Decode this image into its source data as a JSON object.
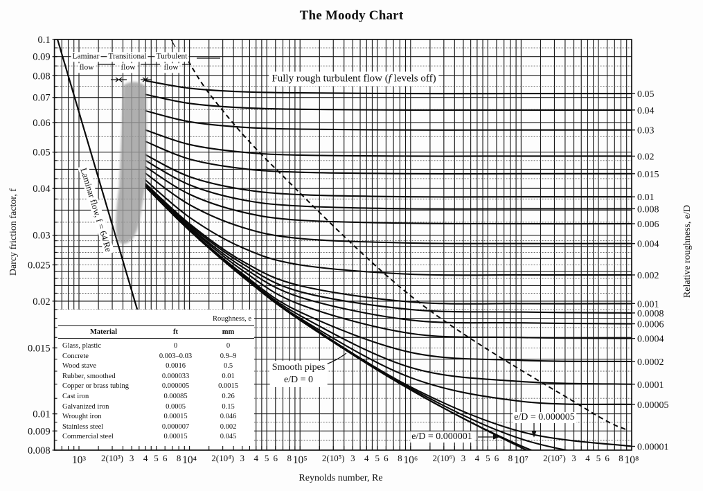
{
  "chart_data": {
    "type": "line",
    "title": "The Moody Chart",
    "xlabel": "Reynolds number, Re",
    "ylabel": "Darcy friction factor, f",
    "y2label": "Relative roughness, e/D",
    "xscale": "log",
    "yscale": "log",
    "xlim": [
      600,
      100000000
    ],
    "ylim": [
      0.008,
      0.1
    ],
    "grid": true,
    "legend": "none",
    "x_ticks": [
      {
        "label": "10³",
        "value": 1000
      },
      {
        "label": "2(10³)",
        "value": 2000
      },
      {
        "label": "3",
        "value": 3000
      },
      {
        "label": "4",
        "value": 4000
      },
      {
        "label": "5",
        "value": 5000
      },
      {
        "label": "6",
        "value": 6000
      },
      {
        "label": "8",
        "value": 8000
      },
      {
        "label": "10⁴",
        "value": 10000
      },
      {
        "label": "2(10⁴)",
        "value": 20000
      },
      {
        "label": "3",
        "value": 30000
      },
      {
        "label": "4",
        "value": 40000
      },
      {
        "label": "5",
        "value": 50000
      },
      {
        "label": "6",
        "value": 60000
      },
      {
        "label": "8",
        "value": 80000
      },
      {
        "label": "10⁵",
        "value": 100000
      },
      {
        "label": "2(10⁵)",
        "value": 200000
      },
      {
        "label": "3",
        "value": 300000
      },
      {
        "label": "4",
        "value": 400000
      },
      {
        "label": "5",
        "value": 500000
      },
      {
        "label": "6",
        "value": 600000
      },
      {
        "label": "8",
        "value": 800000
      },
      {
        "label": "10⁶",
        "value": 1000000
      },
      {
        "label": "2(10⁶)",
        "value": 2000000
      },
      {
        "label": "3",
        "value": 3000000
      },
      {
        "label": "4",
        "value": 4000000
      },
      {
        "label": "5",
        "value": 5000000
      },
      {
        "label": "6",
        "value": 6000000
      },
      {
        "label": "8",
        "value": 8000000
      },
      {
        "label": "10⁷",
        "value": 10000000
      },
      {
        "label": "2(10⁷)",
        "value": 20000000
      },
      {
        "label": "3",
        "value": 30000000
      },
      {
        "label": "4",
        "value": 40000000
      },
      {
        "label": "5",
        "value": 50000000
      },
      {
        "label": "6",
        "value": 60000000
      },
      {
        "label": "8",
        "value": 80000000
      },
      {
        "label": "10⁸",
        "value": 100000000
      }
    ],
    "y_ticks": [
      {
        "label": "0.1",
        "value": 0.1
      },
      {
        "label": "0.09",
        "value": 0.09
      },
      {
        "label": "0.08",
        "value": 0.08
      },
      {
        "label": "0.07",
        "value": 0.07
      },
      {
        "label": "0.06",
        "value": 0.06
      },
      {
        "label": "0.05",
        "value": 0.05
      },
      {
        "label": "0.04",
        "value": 0.04
      },
      {
        "label": "0.03",
        "value": 0.03
      },
      {
        "label": "0.025",
        "value": 0.025
      },
      {
        "label": "0.02",
        "value": 0.02
      },
      {
        "label": "0.015",
        "value": 0.015
      },
      {
        "label": "0.01",
        "value": 0.01
      },
      {
        "label": "0.009",
        "value": 0.009
      },
      {
        "label": "0.008",
        "value": 0.008
      }
    ],
    "x": [
      4000,
      10000,
      30000,
      100000,
      1000000,
      10000000,
      100000000
    ],
    "series": [
      {
        "name": "e/D = 0.05",
        "relative_roughness": 0.05,
        "right_label": "0.05",
        "values": [
          0.0776,
          0.0741,
          0.0725,
          0.072,
          0.0717,
          0.0717,
          0.0717
        ]
      },
      {
        "name": "e/D = 0.04",
        "relative_roughness": 0.04,
        "right_label": "0.04",
        "values": [
          0.0713,
          0.0675,
          0.0657,
          0.0651,
          0.0648,
          0.0648,
          0.0648
        ]
      },
      {
        "name": "e/D = 0.03",
        "relative_roughness": 0.03,
        "right_label": "0.03",
        "values": [
          0.0645,
          0.0603,
          0.0583,
          0.0576,
          0.0573,
          0.0573,
          0.0573
        ]
      },
      {
        "name": "e/D = 0.02",
        "relative_roughness": 0.02,
        "right_label": "0.02",
        "values": [
          0.0573,
          0.0524,
          0.05,
          0.0491,
          0.0488,
          0.0488,
          0.0488
        ]
      },
      {
        "name": "e/D = 0.015",
        "relative_roughness": 0.015,
        "right_label": "0.015",
        "values": [
          0.0534,
          0.0479,
          0.0452,
          0.0442,
          0.0438,
          0.0438,
          0.0438
        ]
      },
      {
        "name": "e/D = 0.01",
        "relative_roughness": 0.01,
        "right_label": "0.01",
        "values": [
          0.0492,
          0.043,
          0.0398,
          0.0385,
          0.038,
          0.038,
          0.038
        ]
      },
      {
        "name": "e/D = 0.008",
        "relative_roughness": 0.008,
        "right_label": "0.008",
        "values": [
          0.0475,
          0.0409,
          0.0373,
          0.0359,
          0.0353,
          0.0353,
          0.0353
        ]
      },
      {
        "name": "e/D = 0.006",
        "relative_roughness": 0.006,
        "right_label": "0.006",
        "values": [
          0.0457,
          0.0386,
          0.0346,
          0.0329,
          0.0323,
          0.0322,
          0.0322
        ]
      },
      {
        "name": "e/D = 0.004",
        "relative_roughness": 0.004,
        "right_label": "0.004",
        "values": [
          0.0439,
          0.0362,
          0.0315,
          0.0294,
          0.0286,
          0.0285,
          0.0285
        ]
      },
      {
        "name": "e/D = 0.002",
        "relative_roughness": 0.002,
        "right_label": "0.002",
        "values": [
          0.0421,
          0.0335,
          0.0278,
          0.025,
          0.0236,
          0.0235,
          0.0235
        ]
      },
      {
        "name": "e/D = 0.001",
        "relative_roughness": 0.001,
        "right_label": "0.001",
        "values": [
          0.0412,
          0.0322,
          0.0256,
          0.022,
          0.0199,
          0.0197,
          0.0197
        ]
      },
      {
        "name": "e/D = 0.0008",
        "relative_roughness": 0.0008,
        "right_label": "0.0008",
        "values": [
          0.041,
          0.0319,
          0.0252,
          0.0212,
          0.019,
          0.0187,
          0.0186
        ]
      },
      {
        "name": "e/D = 0.0006",
        "relative_roughness": 0.0006,
        "right_label": "0.0006",
        "values": [
          0.0409,
          0.0316,
          0.0247,
          0.0205,
          0.0178,
          0.0175,
          0.0174
        ]
      },
      {
        "name": "e/D = 0.0004",
        "relative_roughness": 0.0004,
        "right_label": "0.0004",
        "values": [
          0.0407,
          0.0314,
          0.0242,
          0.0196,
          0.0164,
          0.016,
          0.0159
        ]
      },
      {
        "name": "e/D = 0.0002",
        "relative_roughness": 0.0002,
        "right_label": "0.0002",
        "values": [
          0.0406,
          0.0311,
          0.0237,
          0.0187,
          0.0146,
          0.0139,
          0.0138
        ]
      },
      {
        "name": "e/D = 0.0001",
        "relative_roughness": 0.0001,
        "right_label": "0.0001",
        "values": [
          0.0405,
          0.031,
          0.0235,
          0.0183,
          0.0133,
          0.0122,
          0.012
        ]
      },
      {
        "name": "e/D = 0.00005",
        "relative_roughness": 5e-05,
        "right_label": "0.00005",
        "values": [
          0.0405,
          0.0309,
          0.0234,
          0.018,
          0.0125,
          0.0108,
          0.0106
        ]
      },
      {
        "name": "e/D = 0.00001",
        "relative_roughness": 1e-05,
        "right_label": "0.00001",
        "values": [
          0.0404,
          0.0309,
          0.0233,
          0.0179,
          0.0118,
          0.00896,
          0.00819
        ]
      },
      {
        "name": "e/D = 0.000005",
        "relative_roughness": 5e-06,
        "right_label": null,
        "values": [
          0.0404,
          0.0309,
          0.0233,
          0.0178,
          0.0117,
          0.00857,
          0.00747
        ]
      },
      {
        "name": "e/D = 0.000001",
        "relative_roughness": 1e-06,
        "right_label": null,
        "values": [
          0.0404,
          0.0309,
          0.0233,
          0.0178,
          0.0116,
          0.00821,
          0.00645
        ]
      },
      {
        "name": "Smooth pipes, e/D = 0",
        "relative_roughness": 0,
        "right_label": null,
        "values": [
          0.0404,
          0.0309,
          0.0233,
          0.0178,
          0.0116,
          0.00813,
          0.00602
        ]
      }
    ],
    "laminar": {
      "name": "Laminar flow, f = 64/Re",
      "x": [
        640,
        3368
      ],
      "values": [
        0.1,
        0.019
      ]
    },
    "fully_rough_boundary": {
      "name": "Fully rough turbulent flow boundary",
      "style": "dashed",
      "x": [
        9700,
        16800,
        61300,
        1205000,
        38100000,
        87900000
      ],
      "values": [
        0.0877,
        0.0688,
        0.0449,
        0.0198,
        0.01033,
        0.00909
      ]
    },
    "annotations": {
      "regions": [
        {
          "line1": "Laminar",
          "line2": "flow"
        },
        {
          "line1": "Transitional",
          "line2": "flow"
        },
        {
          "line1": "Turbulent",
          "line2": "flow"
        }
      ],
      "laminar_line": "Laminar flow, f = 64/Re",
      "fully_rough": {
        "prefix": "Fully rough turbulent flow (",
        "italic": "f",
        "suffix": " levels off)"
      },
      "smooth_pipes": {
        "line1": "Smooth pipes",
        "line2": "e/D = 0"
      },
      "ed_000005": "e/D = 0.000005",
      "ed_000001": "e/D = 0.000001"
    }
  },
  "table": {
    "group_header": "Roughness, e",
    "columns": [
      "Material",
      "ft",
      "mm"
    ],
    "rows": [
      [
        "Glass, plastic",
        "0",
        "0"
      ],
      [
        "Concrete",
        "0.003–0.03",
        "0.9–9"
      ],
      [
        "Wood stave",
        "0.0016",
        "0.5"
      ],
      [
        "Rubber, smoothed",
        "0.000033",
        "0.01"
      ],
      [
        "Copper or brass tubing",
        "0.000005",
        "0.0015"
      ],
      [
        "Cast iron",
        "0.00085",
        "0.26"
      ],
      [
        "Galvanized iron",
        "0.0005",
        "0.15"
      ],
      [
        "Wrought iron",
        "0.00015",
        "0.046"
      ],
      [
        "Stainless steel",
        "0.000007",
        "0.002"
      ],
      [
        "Commercial steel",
        "0.00015",
        "0.045"
      ]
    ]
  }
}
